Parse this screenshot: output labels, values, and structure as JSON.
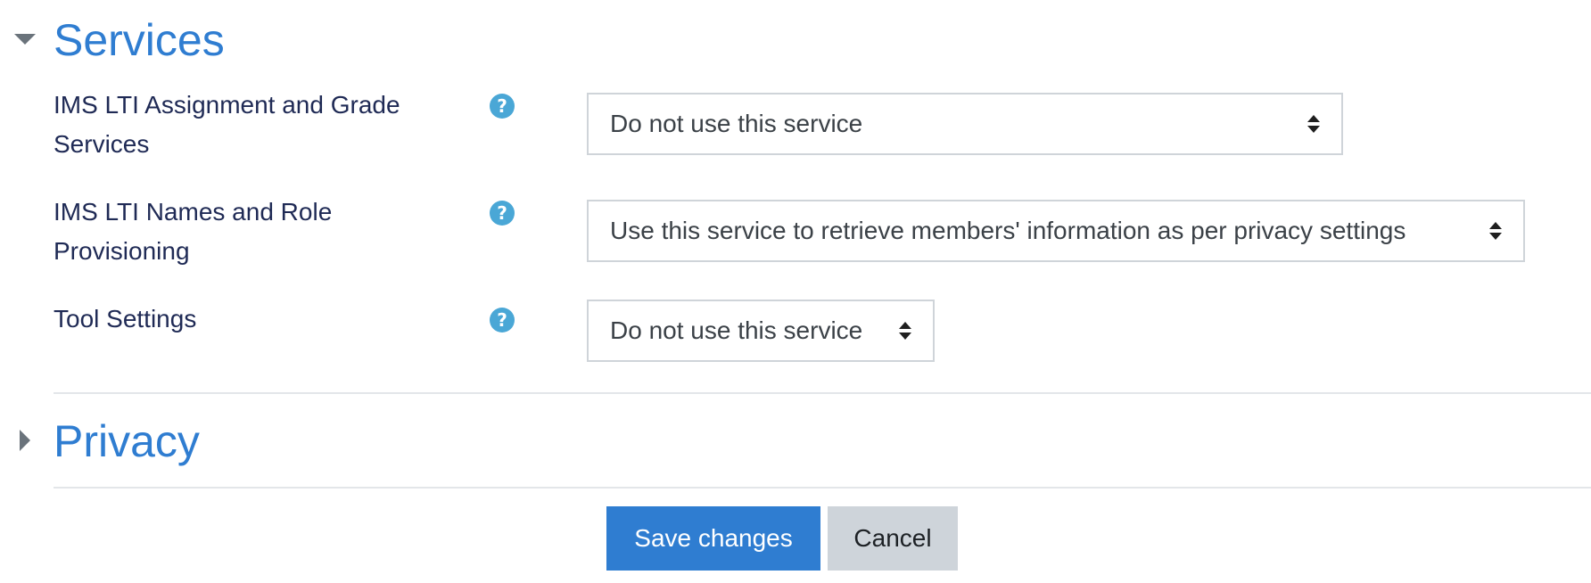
{
  "sections": {
    "services": {
      "title": "Services",
      "expanded": true
    },
    "privacy": {
      "title": "Privacy",
      "expanded": false
    }
  },
  "fields": [
    {
      "label": "IMS LTI Assignment and Grade Services",
      "help_icon": "question-circle-icon",
      "selected": "Do not use this service"
    },
    {
      "label": "IMS LTI Names and Role Provisioning",
      "help_icon": "question-circle-icon",
      "selected": "Use this service to retrieve members' information as per privacy settings"
    },
    {
      "label": "Tool Settings",
      "help_icon": "question-circle-icon",
      "selected": "Do not use this service"
    }
  ],
  "help_glyph": "?",
  "buttons": {
    "save": "Save changes",
    "cancel": "Cancel"
  },
  "colors": {
    "accent": "#2f7dd1",
    "help_icon": "#4aa7d6",
    "label_text": "#1f2a55",
    "secondary_button": "#ced4da"
  }
}
